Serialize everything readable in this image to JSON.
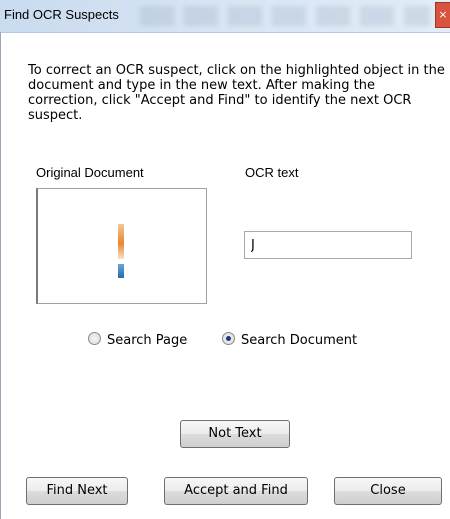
{
  "window": {
    "title": "Find OCR Suspects",
    "close_glyph": "×"
  },
  "instructions": "To correct an OCR suspect, click on the highlighted object in the document and type in the new text. After making the correction, click \"Accept and Find\" to identify the next OCR suspect.",
  "labels": {
    "original_document": "Original Document",
    "ocr_text": "OCR text"
  },
  "ocr_input": {
    "value": "J"
  },
  "search_options": [
    {
      "label": "Search Page",
      "checked": false
    },
    {
      "label": "Search Document",
      "checked": true
    }
  ],
  "buttons": {
    "not_text": "Not Text",
    "find_next": "Find Next",
    "accept_and_find": "Accept and Find",
    "close": "Close"
  },
  "colors": {
    "titlebar": "#d9e6f4",
    "close_button": "#d9543e",
    "radio_selected": "#1b3b7a"
  }
}
